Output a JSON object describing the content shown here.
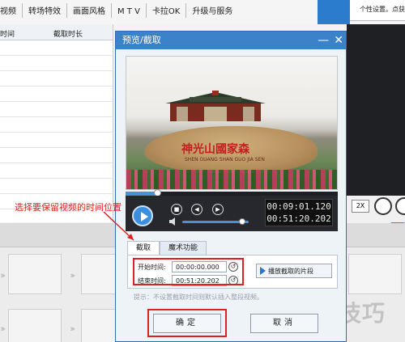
{
  "menubar": {
    "items": [
      "视频",
      "转场特效",
      "画面风格",
      "M T V",
      "卡拉OK",
      "升级与服务"
    ]
  },
  "tooltip": {
    "text": "个性设置。点获"
  },
  "bg_table": {
    "col_time": "时间",
    "col_duration": "截取时长"
  },
  "bg_player": {
    "speed": "2X"
  },
  "watermark": "软件技巧",
  "dialog": {
    "title": "预览/截取",
    "minimize_icon": "—",
    "close_icon": "✕",
    "video": {
      "sign_text": "神光山國家森",
      "sign_sub": "SHEN GUANG SHAN GUO JIA SEN"
    },
    "progress": 0.15,
    "volume": 0.9,
    "time_current": "00:09:01.120",
    "time_total": "00:51:20.202",
    "tabs": [
      {
        "label": "截取",
        "active": true
      },
      {
        "label": "魔术功能",
        "active": false
      }
    ],
    "start_label": "开始时间:",
    "start_value": "00:00:00.000",
    "end_label": "结束时间:",
    "end_value": "00:51:20.202",
    "play_segment_label": "播放截取的片段",
    "hint": "提示：不设置截取时间则默认插入整段视频。",
    "ok_label": "确定",
    "cancel_label": "取消"
  },
  "annotation": {
    "text": "选择要保留视频的时间位置",
    "color": "#e02020"
  },
  "colors": {
    "title_bar": "#3b82c9",
    "highlight": "#e02020"
  }
}
